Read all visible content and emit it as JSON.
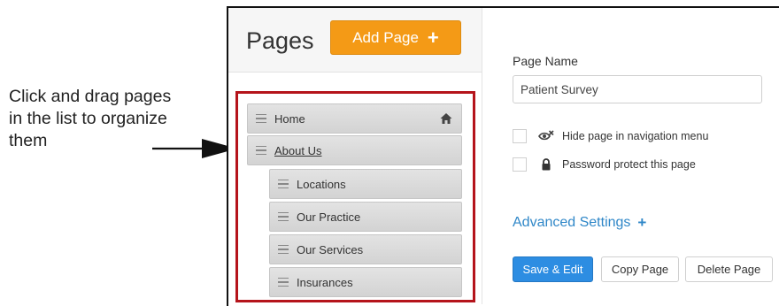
{
  "annotation": {
    "text": "Click and drag pages in the list to organize them"
  },
  "header": {
    "title": "Pages",
    "add_label": "Add Page",
    "add_icon": "plus-icon"
  },
  "page_list": {
    "items": [
      {
        "label": "Home",
        "level": 0,
        "icon": "home-icon"
      },
      {
        "label": "About Us",
        "level": 0,
        "underlined": true
      },
      {
        "label": "Locations",
        "level": 1
      },
      {
        "label": "Our Practice",
        "level": 1
      },
      {
        "label": "Our Services",
        "level": 1
      },
      {
        "label": "Insurances",
        "level": 1
      }
    ]
  },
  "settings": {
    "page_name_label": "Page Name",
    "page_name_value": "Patient Survey",
    "hide_nav_label": "Hide page in navigation menu",
    "hide_nav_icon": "eye-slash-icon",
    "password_label": "Password protect this page",
    "password_icon": "lock-icon",
    "advanced_label": "Advanced Settings",
    "advanced_icon": "plus-icon"
  },
  "actions": {
    "save_label": "Save & Edit",
    "copy_label": "Copy Page",
    "delete_label": "Delete Page"
  },
  "colors": {
    "add_button": "#f49a16",
    "primary_button": "#2d8de2",
    "link": "#2f87c8",
    "highlight_frame": "#b5141b"
  }
}
